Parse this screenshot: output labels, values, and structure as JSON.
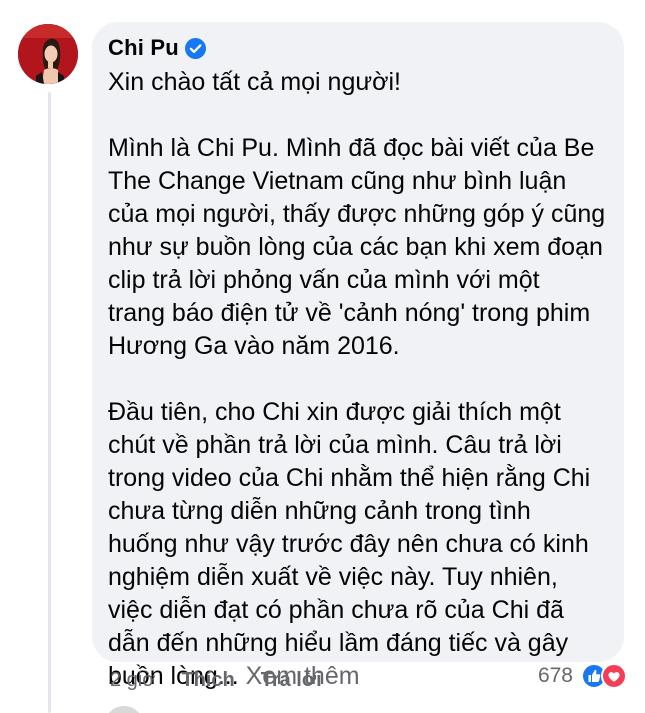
{
  "comment": {
    "author": "Chi Pu",
    "verified_icon": "verified-badge-icon",
    "paragraphs": [
      [
        "Xin chào tất cả mọi người!"
      ],
      [
        "Mình là Chi Pu. Mình đã đọc bài viết của Be",
        "The Change Vietnam cũng như bình luận",
        "của mọi người, thấy được những góp ý cũng",
        "như sự buồn lòng của các bạn khi xem đoạn",
        "clip trả lời phỏng vấn của mình với một",
        "trang báo điện tử về 'cảnh nóng' trong phim",
        "Hương Ga vào năm 2016."
      ],
      [
        "Đầu tiên, cho Chi xin được giải thích một",
        "chút về phần trả lời của mình. Câu trả lời",
        "trong video của Chi nhằm thể hiện rằng Chi",
        "chưa từng diễn những cảnh trong tình",
        "huống như vậy trước đây nên chưa có kinh",
        "nghiệm diễn xuất về việc này. Tuy nhiên,",
        "việc diễn đạt có phần chưa rõ của Chi đã",
        "dẫn đến những hiểu lầm đáng tiếc và gây",
        "buồn lòng..."
      ]
    ],
    "see_more": "Xem thêm"
  },
  "actions": {
    "time": "2 giờ",
    "like": "Thích",
    "reply": "Trả lời"
  },
  "reactions": {
    "count": "678",
    "icons": [
      "like-reaction-icon",
      "love-reaction-icon"
    ]
  },
  "colors": {
    "bubble": "#f0f2f5",
    "text": "#050505",
    "secondary": "#65676b",
    "verified": "#1877f2",
    "like": "#1877f2",
    "love": "#f33e58"
  }
}
